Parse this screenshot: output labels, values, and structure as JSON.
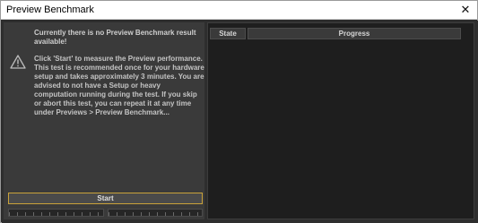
{
  "window": {
    "title": "Preview Benchmark",
    "close_glyph": "✕"
  },
  "left": {
    "heading": "Currently there is no Preview Benchmark result available!",
    "warning_icon": "warning-icon",
    "description": "Click 'Start' to measure the Preview performance. This test is recommended once for your hardware setup and takes approximately 3 minutes. You are advised to not have a Setup or heavy computation running during the test. If you skip or abort this test, you can repeat it at any time under Previews > Preview Benchmark...",
    "start_label": "Start"
  },
  "table": {
    "columns": [
      "State",
      "Progress"
    ]
  },
  "colors": {
    "accent": "#c9a23a",
    "panel": "#3a3a3a",
    "table_bg": "#1e1e1e"
  }
}
